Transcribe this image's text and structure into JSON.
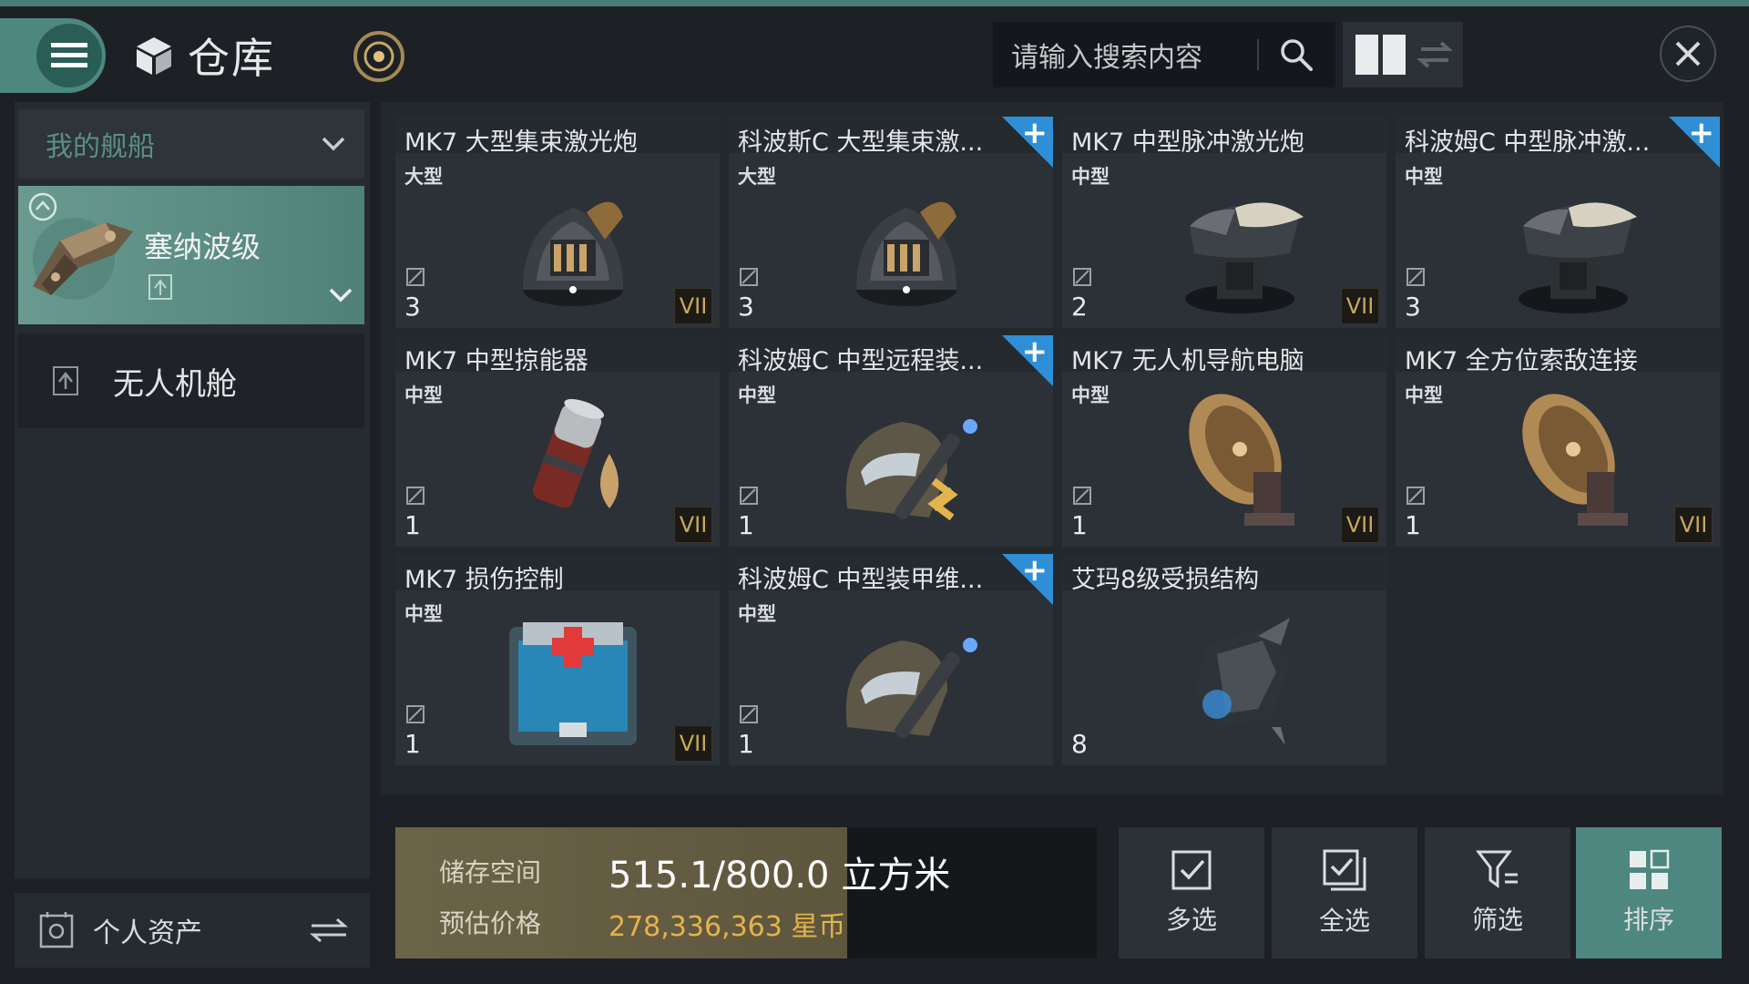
{
  "header": {
    "title": "仓库",
    "search_placeholder": "请输入搜索内容"
  },
  "sidebar": {
    "ship_select_label": "我的舰船",
    "ship_name": "塞纳波级",
    "drone_bay_label": "无人机舱",
    "assets_label": "个人资产"
  },
  "items": [
    {
      "name": "MK7 大型集束激光炮",
      "size": "大型",
      "qty": "3",
      "grade": "VII",
      "plus": false,
      "icon": "beam-laser-turret"
    },
    {
      "name": "科波斯C 大型集束激...",
      "size": "大型",
      "qty": "3",
      "grade": "",
      "plus": true,
      "icon": "beam-laser-turret"
    },
    {
      "name": "MK7 中型脉冲激光炮",
      "size": "中型",
      "qty": "2",
      "grade": "VII",
      "plus": false,
      "icon": "pulse-laser-turret"
    },
    {
      "name": "科波姆C 中型脉冲激...",
      "size": "中型",
      "qty": "3",
      "grade": "",
      "plus": true,
      "icon": "pulse-laser-turret"
    },
    {
      "name": "MK7 中型掠能器",
      "size": "中型",
      "qty": "1",
      "grade": "VII",
      "plus": false,
      "icon": "energy-neutralizer"
    },
    {
      "name": "科波姆C 中型远程装...",
      "size": "中型",
      "qty": "1",
      "grade": "",
      "plus": true,
      "icon": "remote-armor-repairer"
    },
    {
      "name": "MK7 无人机导航电脑",
      "size": "中型",
      "qty": "1",
      "grade": "VII",
      "plus": false,
      "icon": "satellite-dish"
    },
    {
      "name": "MK7 全方位索敌连接",
      "size": "中型",
      "qty": "1",
      "grade": "VII",
      "plus": false,
      "icon": "satellite-dish"
    },
    {
      "name": "MK7 损伤控制",
      "size": "中型",
      "qty": "1",
      "grade": "VII",
      "plus": false,
      "icon": "damage-control-crate"
    },
    {
      "name": "科波姆C 中型装甲维...",
      "size": "中型",
      "qty": "1",
      "grade": "",
      "plus": true,
      "icon": "armor-repairer"
    },
    {
      "name": "艾玛8级受损结构",
      "size": "",
      "qty": "8",
      "grade": "",
      "plus": false,
      "icon": "damaged-structure"
    }
  ],
  "storage": {
    "space_label": "储存空间",
    "space_value": "515.1/800.0 立方米",
    "space_used_fraction": 0.644,
    "price_label": "预估价格",
    "price_value": "278,336,363 星币"
  },
  "actions": {
    "multi_select": "多选",
    "select_all": "全选",
    "filter": "筛选",
    "sort": "排序"
  },
  "colors": {
    "accent_teal": "#4e877f",
    "grade_gold": "#c8a85a",
    "plus_blue": "#2f8fd6",
    "price_gold": "#e3b34d"
  }
}
